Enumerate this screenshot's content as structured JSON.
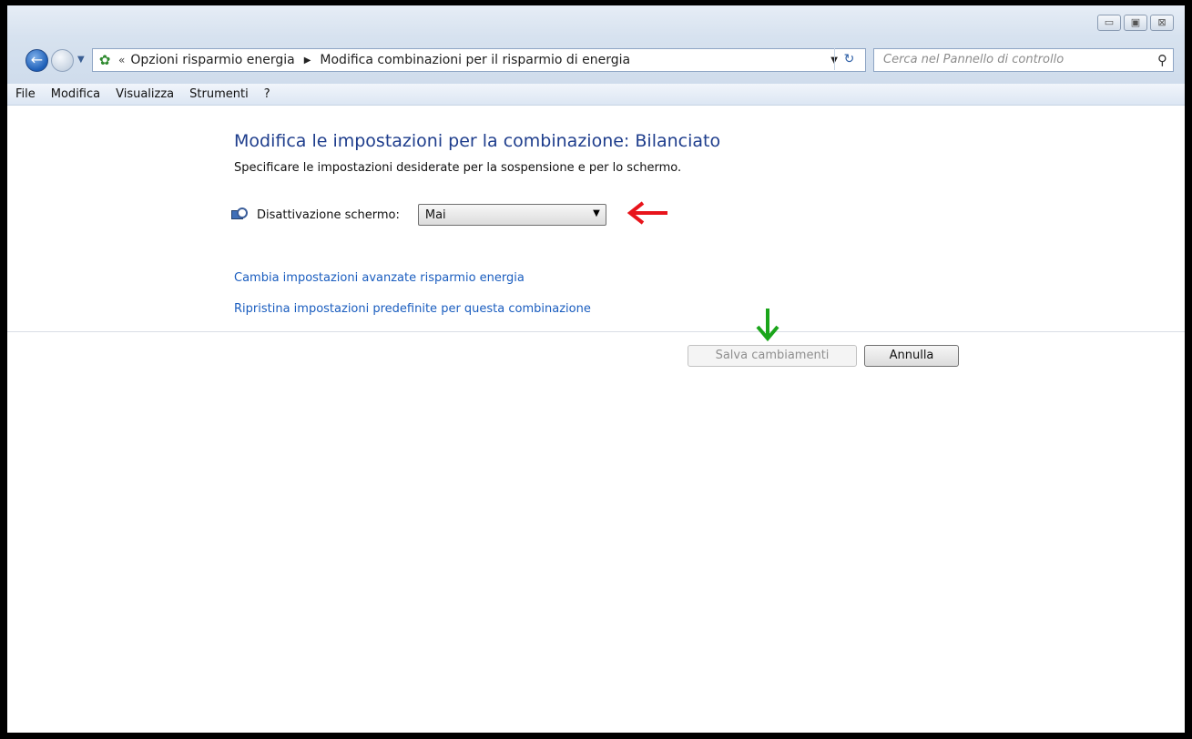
{
  "window": {
    "controls": {
      "minimize": "▭",
      "maximize": "▣",
      "close": "⊠"
    }
  },
  "address": {
    "chevron": "«",
    "crumbs": [
      "Opzioni risparmio energia",
      "Modifica combinazioni per il risparmio di energia"
    ],
    "separator": "▶",
    "icon": "control-panel-icon"
  },
  "search": {
    "placeholder": "Cerca nel Pannello di controllo",
    "icon": "search-icon"
  },
  "menu": [
    "File",
    "Modifica",
    "Visualizza",
    "Strumenti",
    "?"
  ],
  "main": {
    "title": "Modifica le impostazioni per la combinazione: Bilanciato",
    "subtitle": "Specificare le impostazioni desiderate per la sospensione e per lo schermo.",
    "display_off_label": "Disattivazione schermo:",
    "display_off_value": "Mai",
    "link_advanced": "Cambia impostazioni avanzate risparmio energia",
    "link_restore": "Ripristina impostazioni predefinite per questa combinazione",
    "save_label": "Salva cambiamenti",
    "cancel_label": "Annulla"
  },
  "annotations": {
    "red_arrow_color": "#e8141b",
    "green_arrow_color": "#1aa51a"
  }
}
